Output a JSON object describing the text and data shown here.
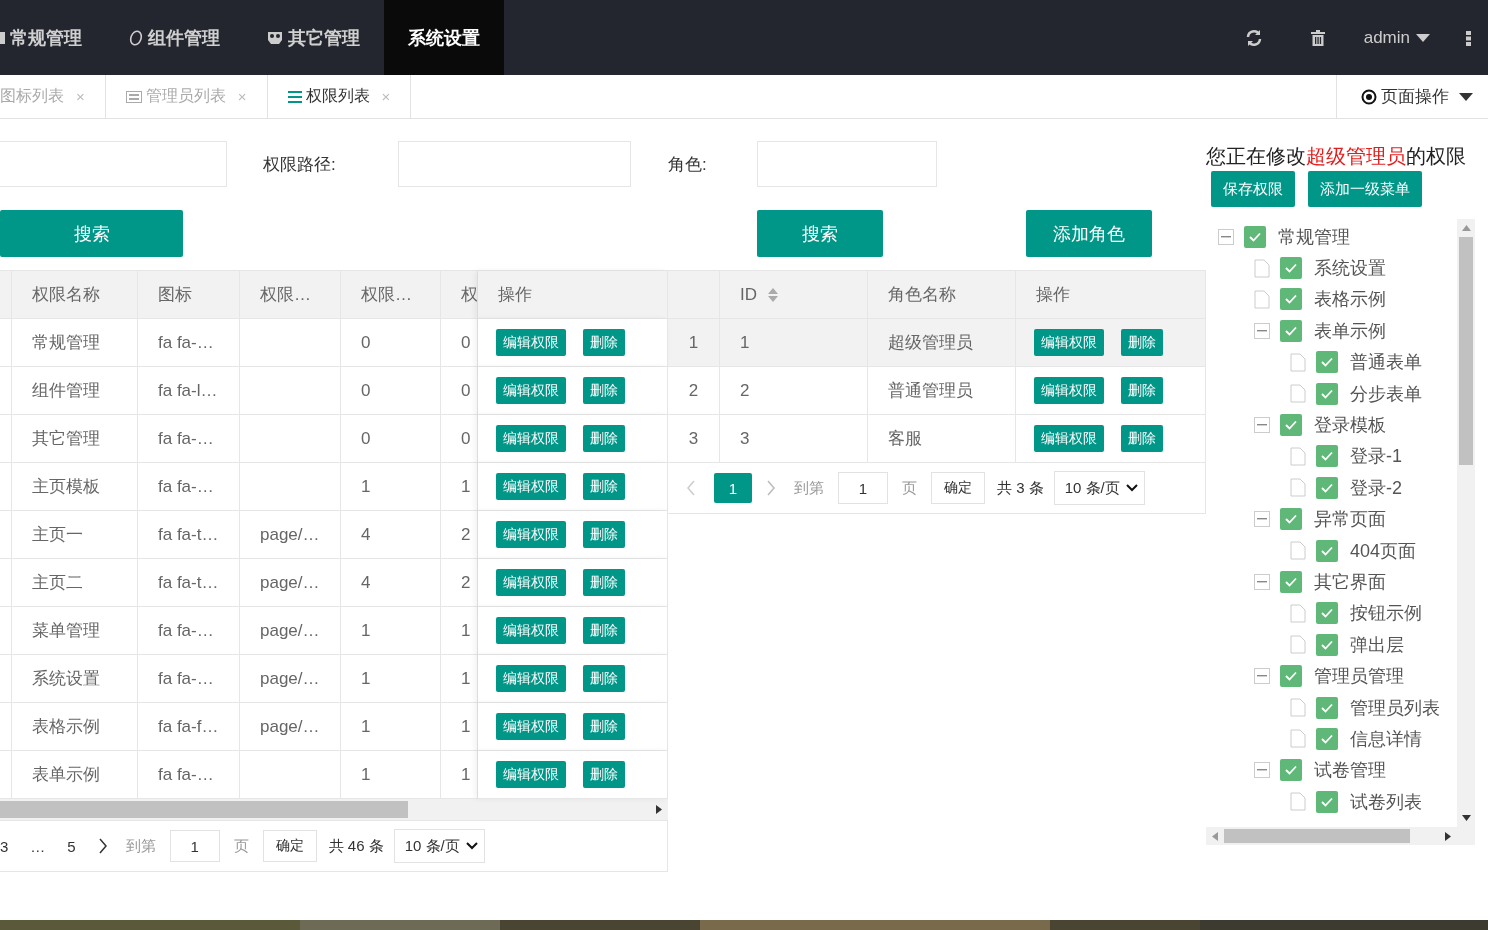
{
  "top_nav": {
    "items": [
      {
        "label": "常规管理",
        "selected": false
      },
      {
        "label": "组件管理",
        "selected": false
      },
      {
        "label": "其它管理",
        "selected": false
      },
      {
        "label": "系统设置",
        "selected": true
      }
    ],
    "user": "admin"
  },
  "tabs": [
    {
      "label": "图标列表",
      "close": "×",
      "selected": false
    },
    {
      "label": "管理员列表",
      "close": "×",
      "selected": false
    },
    {
      "label": "权限列表",
      "close": "×",
      "selected": true
    }
  ],
  "page_actions": "页面操作",
  "permission_panel": {
    "search": {
      "label": "权限路径:",
      "button": "搜索"
    },
    "table": {
      "columns": [
        "权限名称",
        "图标",
        "权限…",
        "权限…",
        "权",
        "操作"
      ],
      "rows": [
        {
          "cells": [
            "常规管理",
            "fa fa-…",
            null,
            "0",
            "0"
          ],
          "actions": [
            "编辑权限",
            "删除"
          ]
        },
        {
          "cells": [
            "组件管理",
            "fa fa-l…",
            null,
            "0",
            "0"
          ],
          "actions": [
            "编辑权限",
            "删除"
          ]
        },
        {
          "cells": [
            "其它管理",
            "fa fa-…",
            null,
            "0",
            "0"
          ],
          "actions": [
            "编辑权限",
            "删除"
          ]
        },
        {
          "cells": [
            "主页模板",
            "fa fa-…",
            null,
            "1",
            "1"
          ],
          "actions": [
            "编辑权限",
            "删除"
          ]
        },
        {
          "cells": [
            "主页一",
            "fa fa-t…",
            "page/…",
            "4",
            "2"
          ],
          "actions": [
            "编辑权限",
            "删除"
          ]
        },
        {
          "cells": [
            "主页二",
            "fa fa-t…",
            "page/…",
            "4",
            "2"
          ],
          "actions": [
            "编辑权限",
            "删除"
          ]
        },
        {
          "cells": [
            "菜单管理",
            "fa fa-…",
            "page/…",
            "1",
            "1"
          ],
          "actions": [
            "编辑权限",
            "删除"
          ]
        },
        {
          "cells": [
            "系统设置",
            "fa fa-…",
            "page/…",
            "1",
            "1"
          ],
          "actions": [
            "编辑权限",
            "删除"
          ]
        },
        {
          "cells": [
            "表格示例",
            "fa fa-f…",
            "page/…",
            "1",
            "1"
          ],
          "actions": [
            "编辑权限",
            "删除"
          ]
        },
        {
          "cells": [
            "表单示例",
            "fa fa-…",
            null,
            "1",
            "1"
          ],
          "actions": [
            "编辑权限",
            "删除"
          ]
        }
      ]
    },
    "pagination": {
      "pages": [
        {
          "label": "3",
          "selected": false
        },
        {
          "label": "…",
          "selected": false
        },
        {
          "label": "5",
          "selected": false
        }
      ],
      "goto_label": "到第",
      "goto_value": "1",
      "page_unit": "页",
      "confirm": "确定",
      "total": "共 46 条",
      "page_size": "10 条/页"
    }
  },
  "role_panel": {
    "search": {
      "label": "角色:",
      "button": "搜索",
      "add_button": "添加角色"
    },
    "table": {
      "columns": [
        "ID",
        "角色名称",
        "操作"
      ],
      "rows": [
        {
          "index": "1",
          "cells": [
            "1",
            "超级管理员"
          ],
          "actions": [
            "编辑权限",
            "删除"
          ],
          "selected": true
        },
        {
          "index": "2",
          "cells": [
            "2",
            "普通管理员"
          ],
          "actions": [
            "编辑权限",
            "删除"
          ],
          "selected": false
        },
        {
          "index": "3",
          "cells": [
            "3",
            "客服"
          ],
          "actions": [
            "编辑权限",
            "删除"
          ],
          "selected": false
        }
      ]
    },
    "pagination": {
      "pages": [
        {
          "label": "1",
          "selected": true
        }
      ],
      "prev_disabled": true,
      "goto_label": "到第",
      "goto_value": "1",
      "page_unit": "页",
      "confirm": "确定",
      "total": "共 3 条",
      "page_size": "10 条/页"
    }
  },
  "editor": {
    "heading": "您正在修改**超级管理员**的权限",
    "buttons": [
      "保存权限",
      "添加一级菜单"
    ],
    "tree": [
      {
        "label": "常规管理",
        "checked": true,
        "expanded": true,
        "children": [
          {
            "label": "系统设置",
            "checked": true
          },
          {
            "label": "表格示例",
            "checked": true
          },
          {
            "label": "表单示例",
            "checked": true,
            "expanded": true,
            "children": [
              {
                "label": "普通表单",
                "checked": true
              },
              {
                "label": "分步表单",
                "checked": true
              }
            ]
          },
          {
            "label": "登录模板",
            "checked": true,
            "expanded": true,
            "children": [
              {
                "label": "登录-1",
                "checked": true
              },
              {
                "label": "登录-2",
                "checked": true
              }
            ]
          },
          {
            "label": "异常页面",
            "checked": true,
            "expanded": true,
            "children": [
              {
                "label": "404页面",
                "checked": true
              }
            ]
          },
          {
            "label": "其它界面",
            "checked": true,
            "expanded": true,
            "children": [
              {
                "label": "按钮示例",
                "checked": true
              },
              {
                "label": "弹出层",
                "checked": true
              }
            ]
          },
          {
            "label": "管理员管理",
            "checked": true,
            "expanded": true,
            "children": [
              {
                "label": "管理员列表",
                "checked": true
              },
              {
                "label": "信息详情",
                "checked": true
              }
            ]
          },
          {
            "label": "试卷管理",
            "checked": true,
            "expanded": true,
            "children": [
              {
                "label": "试卷列表",
                "checked": true
              }
            ]
          }
        ]
      }
    ]
  }
}
